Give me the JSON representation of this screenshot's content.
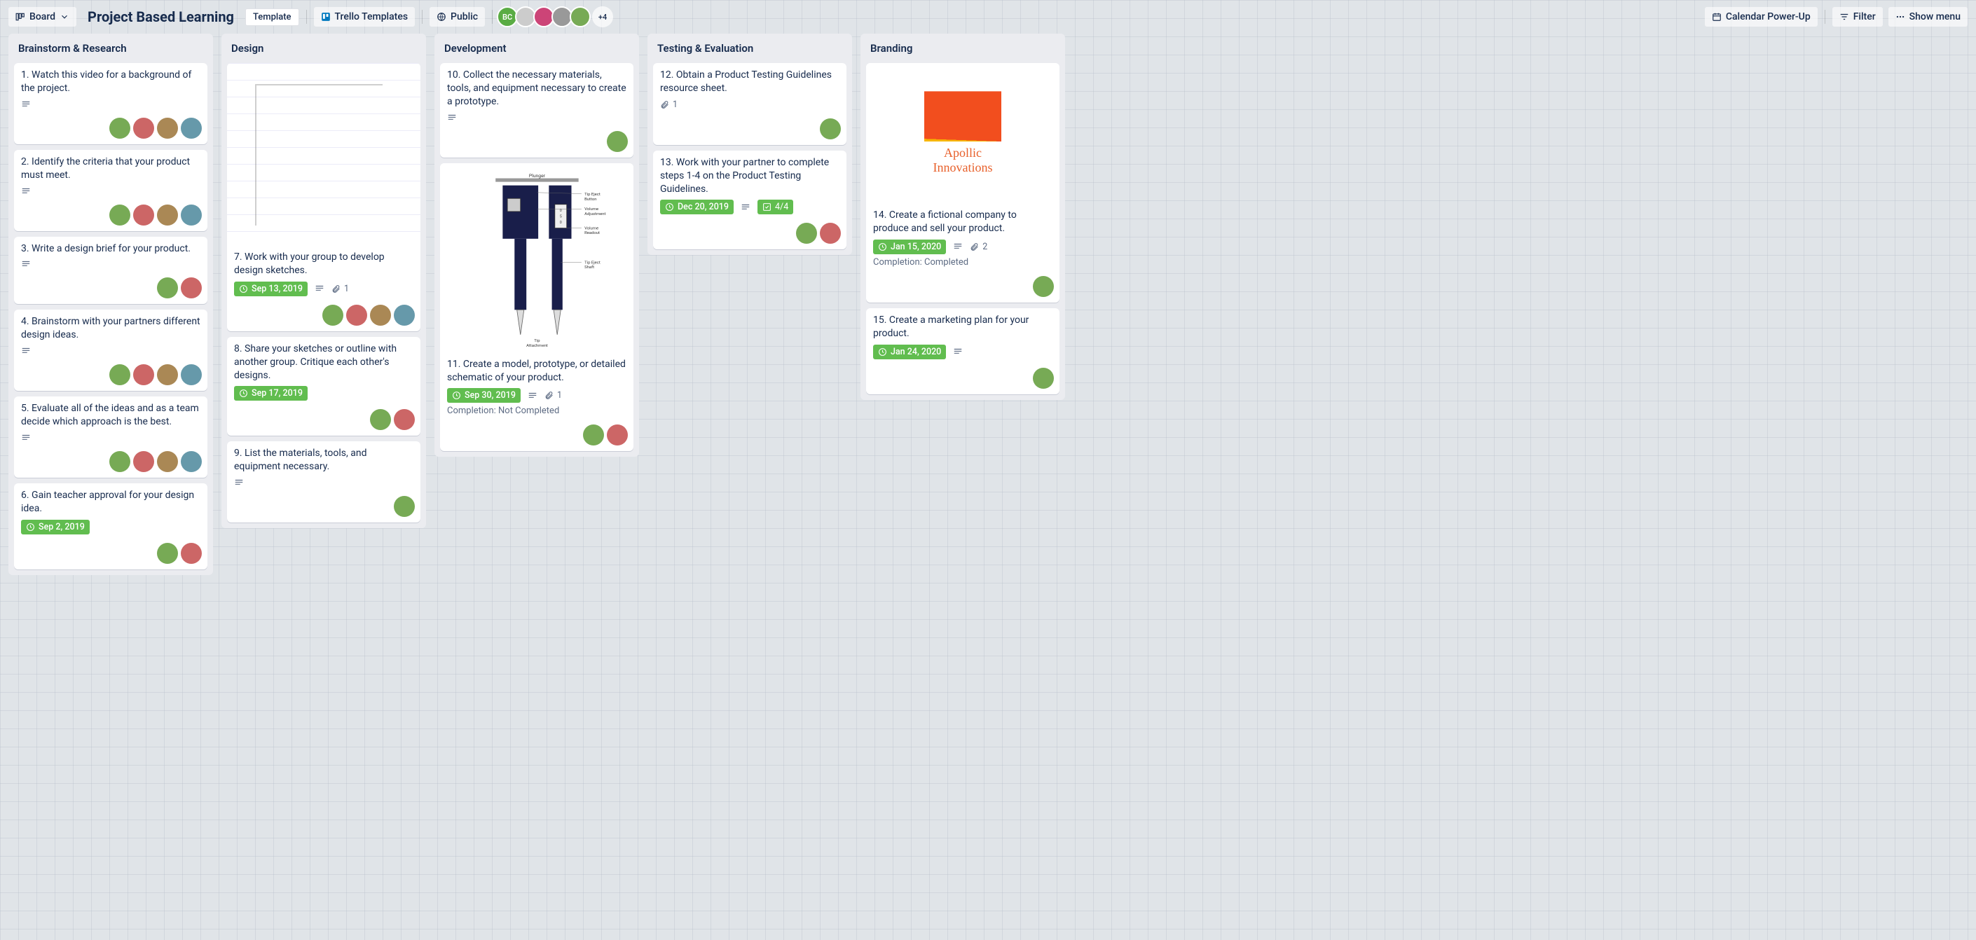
{
  "header": {
    "board_view_label": "Board",
    "board_title": "Project Based Learning",
    "template_label": "Template",
    "workspace_label": "Trello Templates",
    "visibility_label": "Public",
    "extra_members_label": "+4",
    "calendar_label": "Calendar Power-Up",
    "filter_label": "Filter",
    "show_menu_label": "Show menu",
    "member_initials": "BC"
  },
  "lists": [
    {
      "title": "Brainstorm & Research",
      "cards": [
        {
          "title": "1. Watch this video for a background of the project.",
          "desc": true,
          "members": 4
        },
        {
          "title": "2. Identify the criteria that your product must meet.",
          "desc": true,
          "members": 4
        },
        {
          "title": "3. Write a design brief for your product.",
          "desc": true,
          "members": 2
        },
        {
          "title": "4. Brainstorm with your partners different design ideas.",
          "desc": true,
          "members": 4
        },
        {
          "title": "5. Evaluate all of the ideas and as a team decide which approach is the best.",
          "desc": true,
          "members": 4
        },
        {
          "title": "6. Gain teacher approval for your design idea.",
          "due": "Sep 2, 2019",
          "members": 2
        }
      ]
    },
    {
      "title": "Design",
      "cards": [
        {
          "title": "7. Work with your group to develop design sketches.",
          "cover": "sketch",
          "due": "Sep 13, 2019",
          "desc": true,
          "attach": "1",
          "members": 4
        },
        {
          "title": "8. Share your sketches or outline with another group. Critique each other's designs.",
          "due": "Sep 17, 2019",
          "members": 2
        },
        {
          "title": "9. List the materials, tools, and equipment necessary.",
          "desc": true,
          "members": 1
        }
      ]
    },
    {
      "title": "Development",
      "cards": [
        {
          "title": "10. Collect the necessary materials, tools, and equipment necessary to create a prototype.",
          "desc": true,
          "members": 1
        },
        {
          "title": "11. Create a model, prototype, or detailed schematic of your product.",
          "cover": "diagram",
          "due": "Sep 30, 2019",
          "desc": true,
          "attach": "1",
          "completion": "Completion: Not Completed",
          "members": 2
        }
      ]
    },
    {
      "title": "Testing & Evaluation",
      "cards": [
        {
          "title": "12. Obtain a Product Testing Guidelines resource sheet.",
          "attach": "1",
          "members": 1
        },
        {
          "title": "13. Work with your partner to complete steps 1-4 on the Product Testing Guidelines.",
          "due": "Dec 20, 2019",
          "desc": true,
          "checklist": "4/4",
          "members": 2
        }
      ]
    },
    {
      "title": "Branding",
      "cards": [
        {
          "title": "14. Create a fictional company to produce and sell your product.",
          "cover": "logo",
          "logo_text": "Apollic\nInnovations",
          "due": "Jan 15, 2020",
          "desc": true,
          "attach": "2",
          "completion": "Completion: Completed",
          "members": 1
        },
        {
          "title": "15. Create a marketing plan for your product.",
          "due": "Jan 24, 2020",
          "desc": true,
          "members": 1
        }
      ]
    }
  ]
}
